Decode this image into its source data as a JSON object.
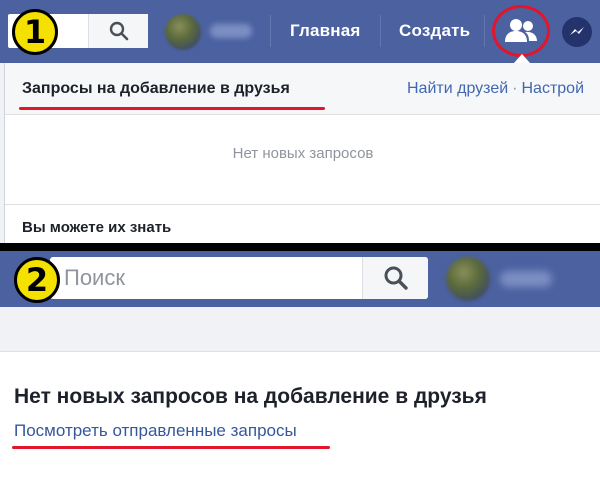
{
  "panel1": {
    "step_number": "1",
    "nav": {
      "home_label": "Главная",
      "create_label": "Создать"
    },
    "icons": {
      "search": "search-icon",
      "friends": "friends-icon",
      "messenger": "messenger-icon"
    },
    "dropdown": {
      "title": "Запросы на добавление в друзья",
      "find_friends_link": "Найти друзей",
      "separator": "·",
      "settings_link": "Настрой",
      "empty_message": "Нет новых запросов",
      "section_heading": "Вы можете их знать"
    }
  },
  "panel2": {
    "step_number": "2",
    "search": {
      "placeholder": "Поиск"
    },
    "card": {
      "title": "Нет новых запросов на добавление в друзья",
      "link": "Посмотреть отправленные запросы"
    }
  },
  "colors": {
    "facebook_bar": "#4b61a0",
    "highlight_red": "#e3152b",
    "badge_yellow": "#f5e100",
    "link_blue": "#4267b2"
  }
}
